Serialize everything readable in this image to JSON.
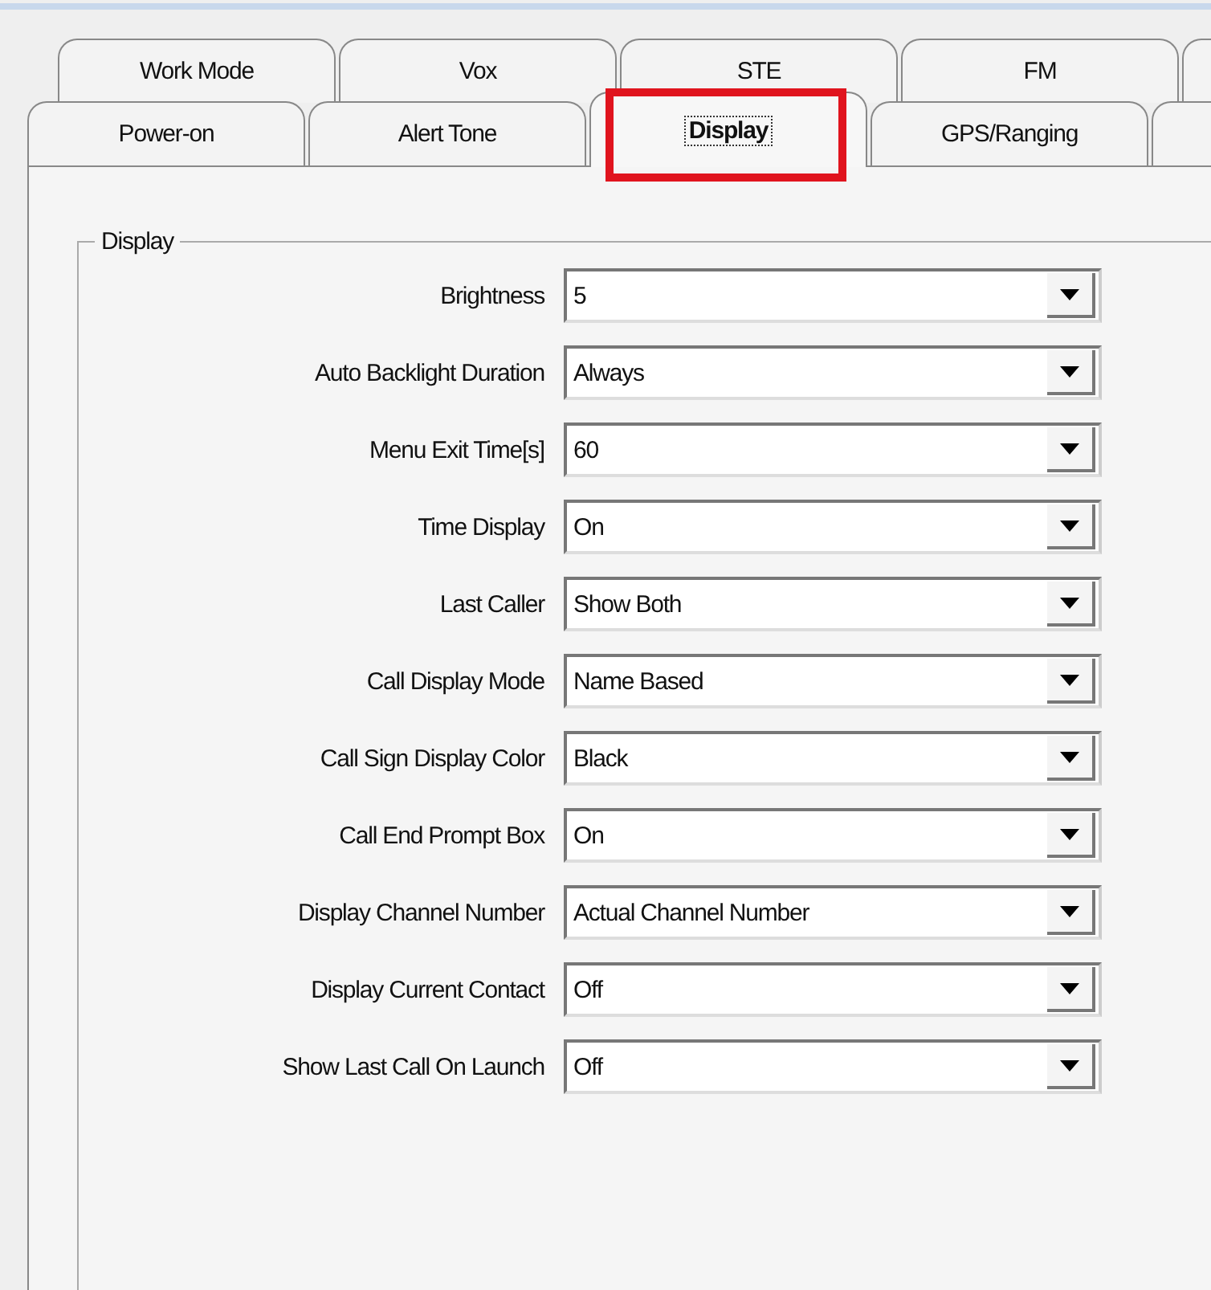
{
  "tab_rows": [
    {
      "tabs": [
        {
          "label": "Work Mode",
          "selected": false
        },
        {
          "label": "Vox",
          "selected": false
        },
        {
          "label": "STE",
          "selected": false
        },
        {
          "label": "FM",
          "selected": false
        }
      ]
    },
    {
      "tabs": [
        {
          "label": "Power-on",
          "selected": false
        },
        {
          "label": "Alert Tone",
          "selected": false
        },
        {
          "label": "Display",
          "selected": true,
          "highlighted": true
        },
        {
          "label": "GPS/Ranging",
          "selected": false
        }
      ]
    }
  ],
  "group": {
    "title": "Display",
    "fields": [
      {
        "label": "Brightness",
        "value": "5"
      },
      {
        "label": "Auto Backlight Duration",
        "value": "Always"
      },
      {
        "label": "Menu Exit Time[s]",
        "value": "60"
      },
      {
        "label": "Time Display",
        "value": "On"
      },
      {
        "label": "Last Caller",
        "value": "Show Both"
      },
      {
        "label": "Call Display Mode",
        "value": "Name Based"
      },
      {
        "label": "Call Sign Display Color",
        "value": "Black"
      },
      {
        "label": "Call End Prompt Box",
        "value": "On"
      },
      {
        "label": "Display Channel Number",
        "value": "Actual Channel Number"
      },
      {
        "label": "Display Current Contact",
        "value": "Off"
      },
      {
        "label": "Show Last Call On Launch",
        "value": "Off"
      }
    ]
  }
}
